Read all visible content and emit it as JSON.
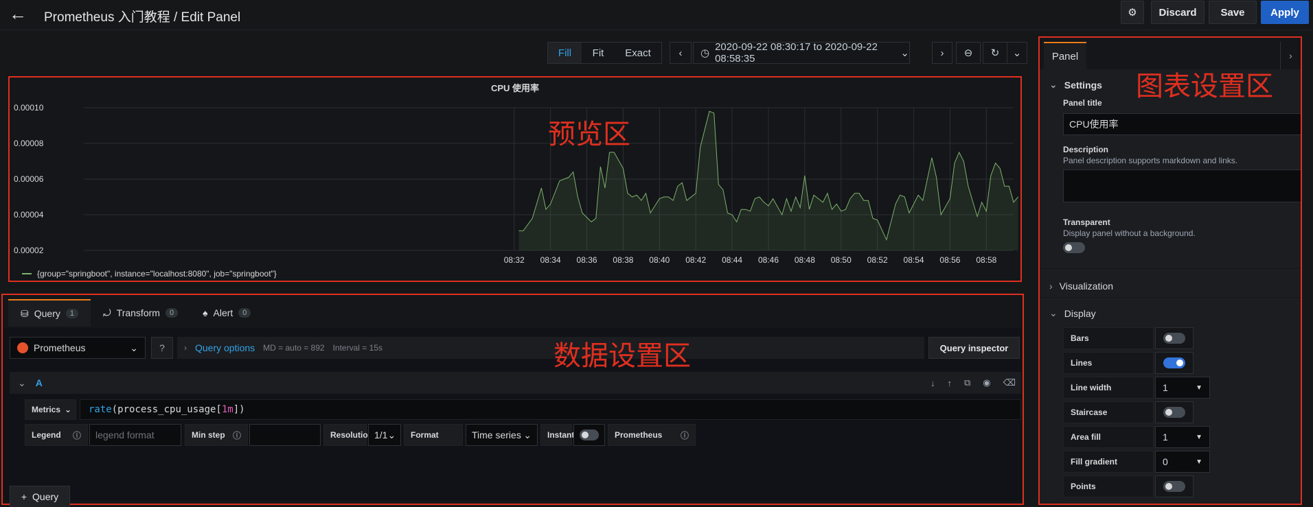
{
  "header": {
    "title": "Prometheus 入门教程 / Edit Panel",
    "discard": "Discard",
    "save": "Save",
    "apply": "Apply"
  },
  "time_controls": {
    "segments": [
      "Fill",
      "Fit",
      "Exact"
    ],
    "active_segment": "Fill",
    "range": "2020-09-22 08:30:17 to 2020-09-22 08:58:35"
  },
  "overlays": {
    "preview": "预览区",
    "data": "数据设置区",
    "settings": "图表设置区"
  },
  "chart_data": {
    "type": "area",
    "title": "CPU 使用率",
    "x_ticks": [
      "08:32",
      "08:34",
      "08:36",
      "08:38",
      "08:40",
      "08:42",
      "08:44",
      "08:46",
      "08:48",
      "08:50",
      "08:52",
      "08:54",
      "08:56",
      "08:58"
    ],
    "y_ticks": [
      "0.00002",
      "0.00004",
      "0.00006",
      "0.00008",
      "0.00010"
    ],
    "ylim": [
      2e-05,
      0.0001
    ],
    "x_range_minutes": [
      8.3,
      59.5
    ],
    "series": [
      {
        "name": "{group=\"springboot\", instance=\"localhost:8080\", job=\"springboot\"}",
        "color": "#7eb26d",
        "points": [
          [
            32.25,
            3.1e-05
          ],
          [
            32.5,
            3.1e-05
          ],
          [
            33,
            3.8e-05
          ],
          [
            33.5,
            5.5e-05
          ],
          [
            33.75,
            4.3e-05
          ],
          [
            34,
            4.6e-05
          ],
          [
            34.5,
            5.9e-05
          ],
          [
            35,
            6.1e-05
          ],
          [
            35.25,
            6.4e-05
          ],
          [
            35.5,
            5e-05
          ],
          [
            35.75,
            4.1e-05
          ],
          [
            36.25,
            3.6e-05
          ],
          [
            36.5,
            3.8e-05
          ],
          [
            36.75,
            6.7e-05
          ],
          [
            37,
            5.5e-05
          ],
          [
            37.25,
            7.5e-05
          ],
          [
            37.5,
            7.5e-05
          ],
          [
            38,
            6.6e-05
          ],
          [
            38.25,
            5.2e-05
          ],
          [
            38.5,
            5e-05
          ],
          [
            38.75,
            5.1e-05
          ],
          [
            39,
            4.8e-05
          ],
          [
            39.25,
            5.2e-05
          ],
          [
            39.5,
            4.1e-05
          ],
          [
            40,
            4.9e-05
          ],
          [
            40.25,
            5e-05
          ],
          [
            40.5,
            5e-05
          ],
          [
            40.75,
            4.8e-05
          ],
          [
            41,
            5.6e-05
          ],
          [
            41.25,
            5.8e-05
          ],
          [
            41.5,
            4.8e-05
          ],
          [
            42,
            5.2e-05
          ],
          [
            42.25,
            7.8e-05
          ],
          [
            42.75,
            9.8e-05
          ],
          [
            43,
            9.7e-05
          ],
          [
            43.25,
            5.7e-05
          ],
          [
            43.5,
            5.4e-05
          ],
          [
            43.75,
            4.1e-05
          ],
          [
            44,
            4e-05
          ],
          [
            44.25,
            3.6e-05
          ],
          [
            44.5,
            4.3e-05
          ],
          [
            44.75,
            4.3e-05
          ],
          [
            45,
            4.2e-05
          ],
          [
            45.25,
            4.9e-05
          ],
          [
            45.5,
            5e-05
          ],
          [
            45.75,
            4.7e-05
          ],
          [
            46,
            4.5e-05
          ],
          [
            46.25,
            4.9e-05
          ],
          [
            46.75,
            4e-05
          ],
          [
            47,
            4.9e-05
          ],
          [
            47.25,
            4.2e-05
          ],
          [
            47.5,
            5e-05
          ],
          [
            47.75,
            4.4e-05
          ],
          [
            48,
            6.2e-05
          ],
          [
            48.25,
            4.3e-05
          ],
          [
            48.5,
            5.1e-05
          ],
          [
            48.75,
            4.9e-05
          ],
          [
            49,
            4.7e-05
          ],
          [
            49.25,
            5.2e-05
          ],
          [
            49.5,
            4.3e-05
          ],
          [
            49.75,
            4.6e-05
          ],
          [
            50,
            4.2e-05
          ],
          [
            50.25,
            4.3e-05
          ],
          [
            50.5,
            4.9e-05
          ],
          [
            50.75,
            5.2e-05
          ],
          [
            51,
            5.2e-05
          ],
          [
            51.25,
            4.8e-05
          ],
          [
            51.5,
            4.8e-05
          ],
          [
            51.75,
            3.8e-05
          ],
          [
            52,
            3.7e-05
          ],
          [
            52.5,
            2.6e-05
          ],
          [
            53,
            4.6e-05
          ],
          [
            53.25,
            5.1e-05
          ],
          [
            53.5,
            5e-05
          ],
          [
            53.75,
            4.1e-05
          ],
          [
            54.25,
            5.1e-05
          ],
          [
            54.5,
            4.8e-05
          ],
          [
            55,
            7.2e-05
          ],
          [
            55.25,
            6.1e-05
          ],
          [
            55.5,
            4e-05
          ],
          [
            56,
            4.9e-05
          ],
          [
            56.25,
            6.9e-05
          ],
          [
            56.5,
            7.5e-05
          ],
          [
            56.75,
            7e-05
          ],
          [
            57,
            5.6e-05
          ],
          [
            57.5,
            3.9e-05
          ],
          [
            57.75,
            4.7e-05
          ],
          [
            58,
            4.2e-05
          ],
          [
            58.25,
            6.2e-05
          ],
          [
            58.5,
            6.9e-05
          ],
          [
            58.75,
            6.6e-05
          ],
          [
            59,
            5.6e-05
          ],
          [
            59.25,
            5.6e-05
          ],
          [
            59.5,
            4.7e-05
          ],
          [
            59.75,
            5e-05
          ]
        ]
      }
    ],
    "legend_position": "bottom-left",
    "grid": true
  },
  "query_tabs": [
    {
      "label": "Query",
      "count": "1"
    },
    {
      "label": "Transform",
      "count": "0"
    },
    {
      "label": "Alert",
      "count": "0"
    }
  ],
  "query": {
    "datasource": "Prometheus",
    "options_label": "Query options",
    "md": "MD = auto = 892",
    "interval": "Interval = 15s",
    "inspector": "Query inspector",
    "ref_id": "A",
    "metrics_label": "Metrics",
    "expr_fn": "rate",
    "expr_open": "(",
    "expr_metric": "process_cpu_usage[",
    "expr_range": "1m",
    "expr_close": "])",
    "legend_label": "Legend",
    "legend_placeholder": "legend format",
    "min_step_label": "Min step",
    "resolution_label": "Resolution",
    "resolution_value": "1/1",
    "format_label": "Format",
    "format_value": "Time series",
    "instant_label": "Instant",
    "instant_on": false,
    "prom_label": "Prometheus",
    "add_query": "Query"
  },
  "sidebar": {
    "tab": "Panel",
    "settings_title": "Settings",
    "panel_title_label": "Panel title",
    "panel_title_value": "CPU使用率",
    "description_label": "Description",
    "description_hint": "Panel description supports markdown and links.",
    "transparent_label": "Transparent",
    "transparent_hint": "Display panel without a background.",
    "visualization_title": "Visualization",
    "display_title": "Display",
    "display_rows": [
      {
        "label": "Bars",
        "kind": "toggle",
        "on": false
      },
      {
        "label": "Lines",
        "kind": "toggle",
        "on": true
      },
      {
        "label": "Line width",
        "kind": "select",
        "value": "1"
      },
      {
        "label": "Staircase",
        "kind": "toggle",
        "on": false
      },
      {
        "label": "Area fill",
        "kind": "select",
        "value": "1"
      },
      {
        "label": "Fill gradient",
        "kind": "select",
        "value": "0"
      },
      {
        "label": "Points",
        "kind": "toggle",
        "on": false
      }
    ]
  }
}
